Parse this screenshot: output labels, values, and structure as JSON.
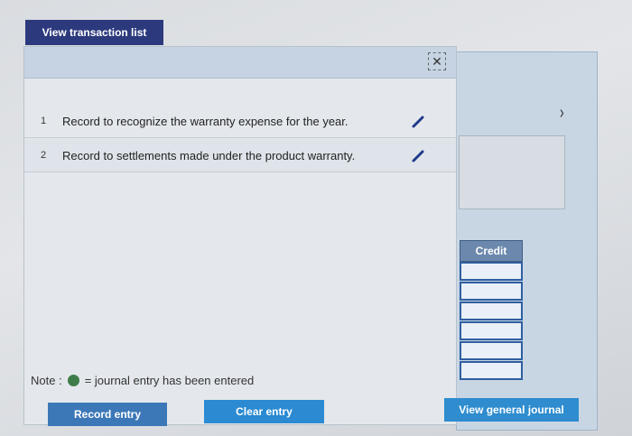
{
  "toolbar": {
    "view_transaction_list": "View transaction list"
  },
  "transactions": [
    {
      "number": "1",
      "text": "Record to recognize the warranty expense for the year."
    },
    {
      "number": "2",
      "text": "Record to settlements made under the product warranty."
    }
  ],
  "journal": {
    "credit_header": "Credit",
    "chevron": "›"
  },
  "note": {
    "label": "Note :",
    "text": "= journal entry has been entered",
    "dot_color": "#3e7d4a"
  },
  "buttons": {
    "record_entry": "Record entry",
    "clear_entry": "Clear entry",
    "view_general_journal": "View general journal"
  },
  "colors": {
    "header_dark": "#2c3a7d",
    "button_blue": "#2b8ad2",
    "credit_header": "#6c89ad"
  }
}
